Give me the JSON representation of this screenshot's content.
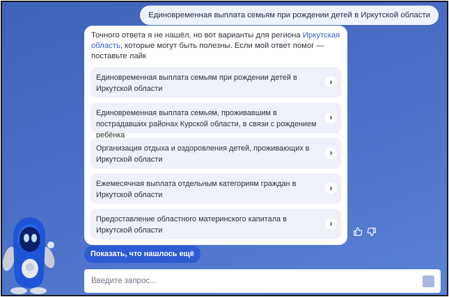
{
  "chat": {
    "user_message": "Единовременная выплата семьям при рождении детей в Иркутской области",
    "bot_intro_before": "Точного ответа я не нашёл, но вот варианты для региона ",
    "bot_intro_region": "Иркутская область",
    "bot_intro_after": ", которые могут быть полезны. Если мой ответ помог — поставьте лайк",
    "options": [
      "Единовременная выплата семьям при рождении детей в Иркутской области",
      "Единовременная выплата семьям, проживавшим в пострадавших районах Курской области, в связи с рождением ребёнка",
      "Организация отдыха и оздоровления детей, проживающих в Иркутской области",
      "Ежемесячная выплата отдельным категориям граждан в Иркутской области",
      "Предоставление областного материнского капитала в Иркутской области"
    ],
    "chevron": "›",
    "show_more_label": "Показать, что нашлось ещё"
  },
  "input": {
    "placeholder": "Введите запрос..."
  },
  "icons": {
    "like": "thumbs-up-icon",
    "dislike": "thumbs-down-icon",
    "send": "send-icon",
    "assistant": "robot-assistant-icon"
  },
  "colors": {
    "background": "#4a6ec6",
    "accent": "#2d5bd4",
    "link": "#2f5fd0",
    "option_bg": "#eef1f9"
  }
}
